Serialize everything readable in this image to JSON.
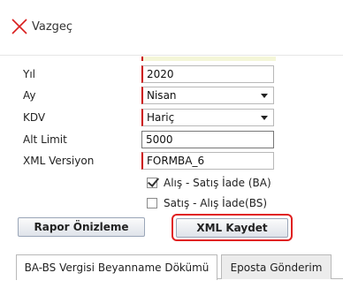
{
  "cancel": {
    "label": "Vazgeç",
    "icon": "close-icon"
  },
  "form": {
    "year": {
      "label": "Yıl",
      "value": "2020"
    },
    "month": {
      "label": "Ay",
      "value": "Nisan"
    },
    "kdv": {
      "label": "KDV",
      "value": "Hariç"
    },
    "limit": {
      "label": "Alt Limit",
      "value": "5000"
    },
    "xml_version": {
      "label": "XML Versiyon",
      "value": "FORMBA_6"
    }
  },
  "checks": [
    {
      "label": "Alış - Satış İade (BA)",
      "checked": true
    },
    {
      "label": "Satış - Alış İade(BS)",
      "checked": false
    }
  ],
  "buttons": {
    "preview": "Rapor Önizleme",
    "save_xml": "XML Kaydet"
  },
  "tabs": [
    {
      "label": "BA-BS Vergisi Beyanname Dökümü",
      "active": true
    },
    {
      "label": "Eposta Gönderim",
      "active": false
    }
  ],
  "colors": {
    "required_marker": "#cc0000",
    "highlight": "#e02020"
  }
}
